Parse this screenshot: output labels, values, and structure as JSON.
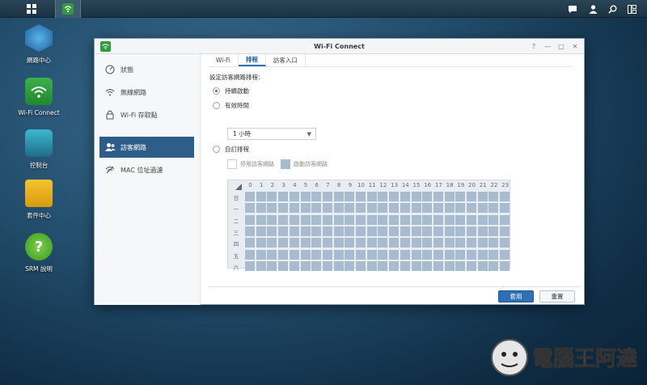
{
  "desktop": {
    "icons": [
      {
        "label": "網路中心"
      },
      {
        "label": "Wi-Fi Connect"
      },
      {
        "label": "控制台"
      },
      {
        "label": "套件中心"
      },
      {
        "label": "SRM 說明"
      }
    ]
  },
  "window": {
    "title": "Wi-Fi Connect",
    "controls": {
      "help": "?",
      "minimize": "—",
      "maximize": "□",
      "close": "✕"
    }
  },
  "sidebar": {
    "items": [
      {
        "label": "狀態",
        "icon": "gauge-icon"
      },
      {
        "label": "無線網路",
        "icon": "wifi-icon"
      },
      {
        "label": "Wi-Fi 存取點",
        "icon": "lock-icon"
      },
      {
        "label": "訪客網路",
        "icon": "guest-users-icon",
        "active": true
      },
      {
        "label": "MAC 位址過濾",
        "icon": "wifi-filter-icon"
      }
    ]
  },
  "tabs": [
    {
      "label": "Wi-Fi"
    },
    {
      "label": "排程",
      "active": true
    },
    {
      "label": "訪客入口"
    }
  ],
  "schedule": {
    "section_title": "設定訪客網路排程：",
    "options": [
      {
        "label": "持續啟動",
        "selected": true
      },
      {
        "label": "有效時間",
        "selected": false
      },
      {
        "label": "自訂排程",
        "selected": false
      }
    ],
    "duration_value": "1 小時",
    "legend_disable": "停用訪客網路",
    "legend_enable": "啟動訪客網路",
    "hours": [
      "0",
      "1",
      "2",
      "3",
      "4",
      "5",
      "6",
      "7",
      "8",
      "9",
      "10",
      "11",
      "12",
      "13",
      "14",
      "15",
      "16",
      "17",
      "18",
      "19",
      "20",
      "21",
      "22",
      "23"
    ],
    "days": [
      "日",
      "一",
      "二",
      "三",
      "四",
      "五",
      "六"
    ]
  },
  "buttons": {
    "apply": "套用",
    "reset": "重置"
  },
  "colors": {
    "accent": "#2f6fb3",
    "active_sidebar": "#2f5d8a",
    "grid_cell": "#a9bccf"
  },
  "watermark": "電腦王阿達"
}
